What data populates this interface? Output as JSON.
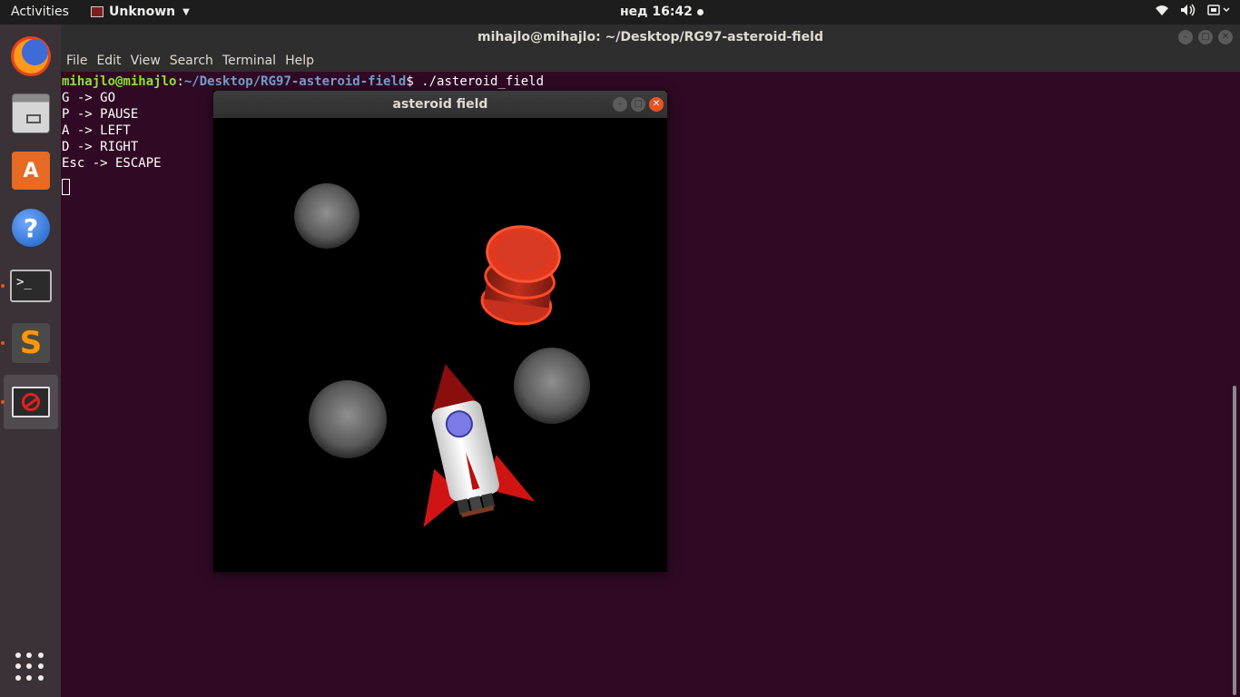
{
  "topbar": {
    "activities": "Activities",
    "app_name": "Unknown",
    "clock": "нед 16:42",
    "tray_icons": [
      "wifi-icon",
      "volume-icon",
      "power-icon"
    ]
  },
  "dock": {
    "items": [
      "firefox-icon",
      "files-icon",
      "software-icon",
      "help-icon",
      "terminal-icon",
      "sublime-icon",
      "broken-app-icon"
    ],
    "show_apps": "show-applications-icon"
  },
  "terminal": {
    "title": "mihajlo@mihajlo: ~/Desktop/RG97-asteroid-field",
    "menu": [
      "File",
      "Edit",
      "View",
      "Search",
      "Terminal",
      "Help"
    ],
    "prompt_user": "mihajlo@mihajlo",
    "prompt_path": "~/Desktop/RG97-asteroid-field",
    "command": "$ ./asteroid_field",
    "output": [
      "G -> GO",
      "P -> PAUSE",
      "A -> LEFT",
      "D -> RIGHT",
      "Esc -> ESCAPE"
    ]
  },
  "game": {
    "title": "asteroid field"
  },
  "colors": {
    "terminal_bg": "#300a24",
    "prompt_user": "#8ae234",
    "prompt_path": "#729fcf",
    "accent": "#e95420"
  }
}
